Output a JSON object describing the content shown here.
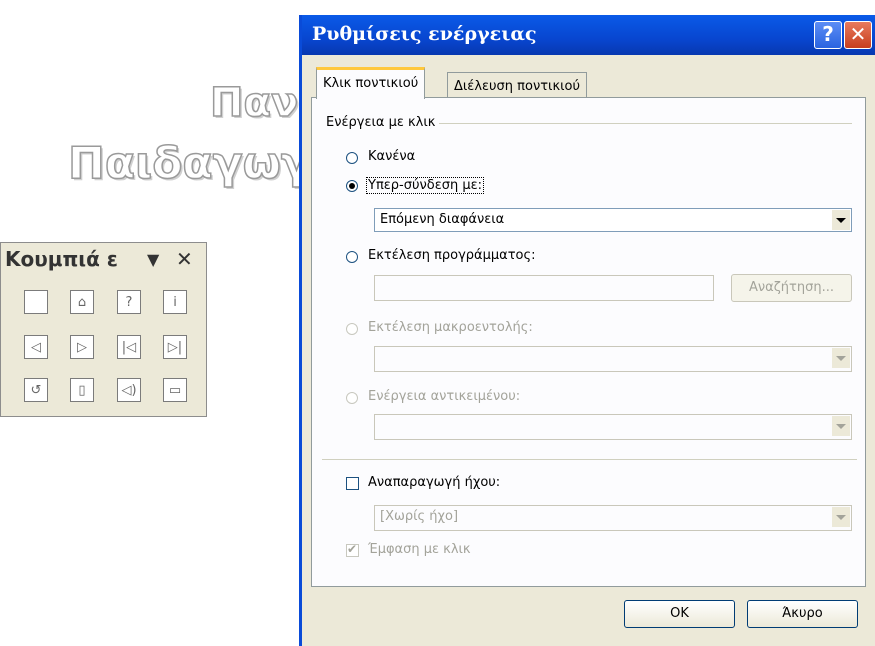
{
  "background": {
    "line1": "Πανε",
    "line2": "Παιδαγωγικό"
  },
  "toolbar": {
    "title": "Κουμπιά ε",
    "dropdown_glyph": "▼",
    "close_glyph": "✕",
    "buttons": [
      {
        "icon": "custom-button",
        "glyph": ""
      },
      {
        "icon": "home-icon",
        "glyph": "⌂"
      },
      {
        "icon": "help-icon",
        "glyph": "?"
      },
      {
        "icon": "information-icon",
        "glyph": "i"
      },
      {
        "icon": "back-icon",
        "glyph": "◁"
      },
      {
        "icon": "forward-icon",
        "glyph": "▷"
      },
      {
        "icon": "beginning-icon",
        "glyph": "|◁"
      },
      {
        "icon": "end-icon",
        "glyph": "▷|"
      },
      {
        "icon": "return-icon",
        "glyph": "↺"
      },
      {
        "icon": "document-icon",
        "glyph": "▯"
      },
      {
        "icon": "sound-icon",
        "glyph": "◁)"
      },
      {
        "icon": "movie-icon",
        "glyph": "▭"
      }
    ]
  },
  "dialog": {
    "title": "Ρυθμίσεις ενέργειας",
    "help_glyph": "?",
    "close_glyph": "✕",
    "tabs": [
      {
        "label": "Κλικ ποντικιού",
        "active": true
      },
      {
        "label": "Διέλευση ποντικιού",
        "active": false
      }
    ],
    "group_label": "Ενέργεια με κλικ",
    "options": {
      "none": "Κανένα",
      "hyperlink": "Υπερ-σύνδεση με:",
      "hyperlink_value": "Επόμενη διαφάνεια",
      "run_program": "Εκτέλεση προγράμματος:",
      "run_program_value": "",
      "browse": "Αναζήτηση...",
      "run_macro": "Εκτέλεση μακροεντολής:",
      "object_action": "Ενέργεια αντικειμένου:"
    },
    "selected_option": "hyperlink",
    "play_sound": "Αναπαραγωγή ήχου:",
    "sound_value": "[Χωρίς ήχο]",
    "highlight_click": "Έμφαση με κλικ",
    "ok": "OK",
    "cancel": "Άκυρο"
  },
  "colors": {
    "titlebar": "#0a4bd8",
    "dialog_face": "#ece9d8",
    "close_red": "#c73e1d",
    "tab_highlight": "#ffc83c"
  }
}
